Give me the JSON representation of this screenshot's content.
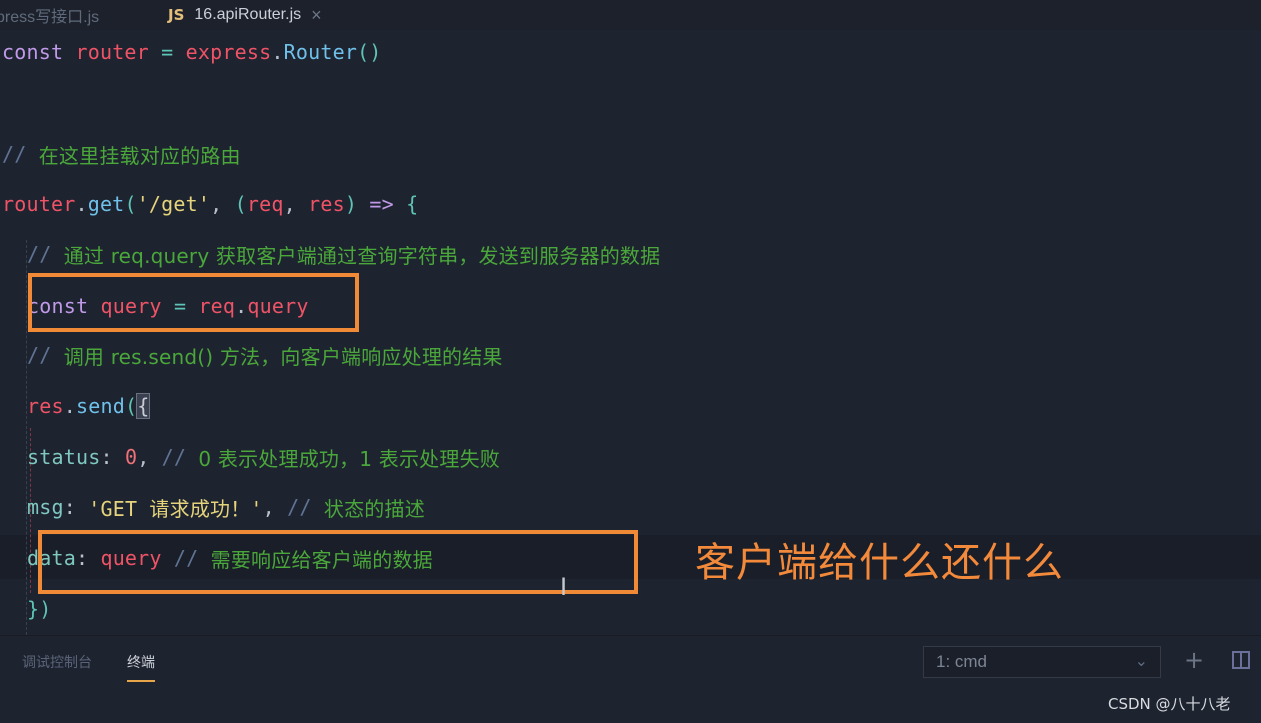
{
  "tabs": [
    {
      "label": "press写接口.js",
      "active": false
    },
    {
      "label": "16.apiRouter.js",
      "active": true,
      "icon": "JS"
    }
  ],
  "tab_close_glyph": "×",
  "code_lines": [
    {
      "tokens": [
        [
          "kw",
          "const"
        ],
        [
          "sp",
          " "
        ],
        [
          "var",
          "router"
        ],
        [
          "sp",
          " "
        ],
        [
          "op",
          "="
        ],
        [
          "sp",
          " "
        ],
        [
          "var",
          "express"
        ],
        [
          "punc",
          "."
        ],
        [
          "fn",
          "Router"
        ],
        [
          "op",
          "()"
        ]
      ]
    },
    {
      "tokens": []
    },
    {
      "tokens": []
    },
    {
      "tokens": [
        [
          "cmt-slash",
          "// "
        ],
        [
          "cmt",
          "在这里挂载对应的路由"
        ]
      ]
    },
    {
      "tokens": [
        [
          "var",
          "router"
        ],
        [
          "punc",
          "."
        ],
        [
          "fn",
          "get"
        ],
        [
          "op",
          "("
        ],
        [
          "str-gold",
          "'/get'"
        ],
        [
          "punc",
          ", "
        ],
        [
          "op",
          "("
        ],
        [
          "var",
          "req"
        ],
        [
          "punc",
          ", "
        ],
        [
          "var",
          "res"
        ],
        [
          "op",
          ")"
        ],
        [
          "sp",
          " "
        ],
        [
          "kw",
          "=>"
        ],
        [
          "sp",
          " "
        ],
        [
          "op",
          "{"
        ]
      ]
    },
    {
      "tokens": [
        [
          "sp",
          "  "
        ],
        [
          "cmt-slash",
          "// "
        ],
        [
          "cmt",
          "通过 req.query 获取客户端通过查询字符串，发送到服务器的数据"
        ]
      ]
    },
    {
      "tokens": [
        [
          "sp",
          "  "
        ],
        [
          "kw",
          "const"
        ],
        [
          "sp",
          " "
        ],
        [
          "var",
          "query"
        ],
        [
          "sp",
          " "
        ],
        [
          "op",
          "="
        ],
        [
          "sp",
          " "
        ],
        [
          "var",
          "req"
        ],
        [
          "punc",
          "."
        ],
        [
          "var",
          "query"
        ]
      ]
    },
    {
      "tokens": [
        [
          "sp",
          "  "
        ],
        [
          "cmt-slash",
          "// "
        ],
        [
          "cmt",
          "调用 res.send() 方法，向客户端响应处理的结果"
        ]
      ]
    },
    {
      "tokens": [
        [
          "sp",
          "  "
        ],
        [
          "var",
          "res"
        ],
        [
          "punc",
          "."
        ],
        [
          "fn",
          "send"
        ],
        [
          "op",
          "("
        ],
        [
          "bracket-hl",
          "{"
        ]
      ]
    },
    {
      "tokens": [
        [
          "sp",
          "    "
        ],
        [
          "prop",
          "status"
        ],
        [
          "punc",
          ": "
        ],
        [
          "num",
          "0"
        ],
        [
          "punc",
          ", "
        ],
        [
          "cmt-slash",
          "// "
        ],
        [
          "cmt",
          "0 表示处理成功，1 表示处理失败"
        ]
      ]
    },
    {
      "tokens": [
        [
          "sp",
          "    "
        ],
        [
          "prop",
          "msg"
        ],
        [
          "punc",
          ": "
        ],
        [
          "str-gold",
          "'GET 请求成功！'"
        ],
        [
          "punc",
          ", "
        ],
        [
          "cmt-slash",
          "// "
        ],
        [
          "cmt",
          "状态的描述"
        ]
      ]
    },
    {
      "tokens": [
        [
          "sp",
          "    "
        ],
        [
          "prop",
          "data"
        ],
        [
          "punc",
          ": "
        ],
        [
          "var",
          "query"
        ],
        [
          "sp",
          " "
        ],
        [
          "cmt-slash",
          "// "
        ],
        [
          "cmt",
          "需要响应给客户端的数据"
        ]
      ]
    },
    {
      "tokens": [
        [
          "sp",
          "  "
        ],
        [
          "op",
          "})"
        ]
      ]
    }
  ],
  "annotation": {
    "text": "客户端给什么还什么",
    "color": "#f08a36"
  },
  "panel": {
    "tabs": [
      {
        "label": "调试控制台",
        "active": false
      },
      {
        "label": "终端",
        "active": true
      }
    ],
    "terminal_select": "1: cmd",
    "add_terminal_glyph": "+",
    "split_terminal_icon": "split-icon"
  },
  "watermark": "CSDN @八十八老"
}
